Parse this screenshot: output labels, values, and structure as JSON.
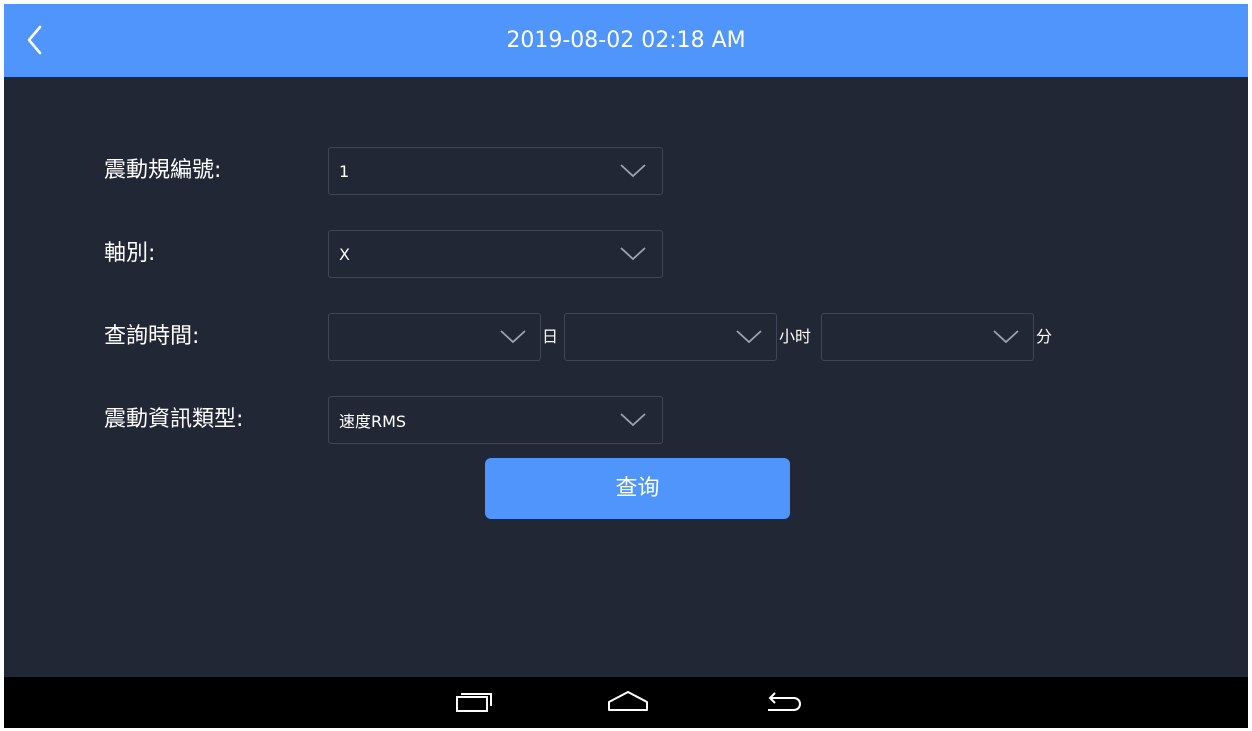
{
  "header": {
    "title": "2019-08-02 02:18 AM",
    "back_icon": "chevron-left-icon"
  },
  "form": {
    "sensor_no": {
      "label": "震動規編號:",
      "value": "1"
    },
    "axis": {
      "label": "軸別:",
      "value": "X"
    },
    "query_time": {
      "label": "查詢時間:",
      "day": {
        "value": "",
        "unit": "日"
      },
      "hour": {
        "value": "",
        "unit": "小时"
      },
      "minute": {
        "value": "",
        "unit": "分"
      }
    },
    "info_type": {
      "label": "震動資訊類型:",
      "value": "速度RMS"
    }
  },
  "query_button": {
    "label": "查询"
  },
  "navbar": {
    "icons": [
      "recent-apps-icon",
      "home-icon",
      "back-icon"
    ]
  },
  "colors": {
    "accent": "#4f95fb",
    "background": "#212735",
    "border": "#3f4656"
  }
}
